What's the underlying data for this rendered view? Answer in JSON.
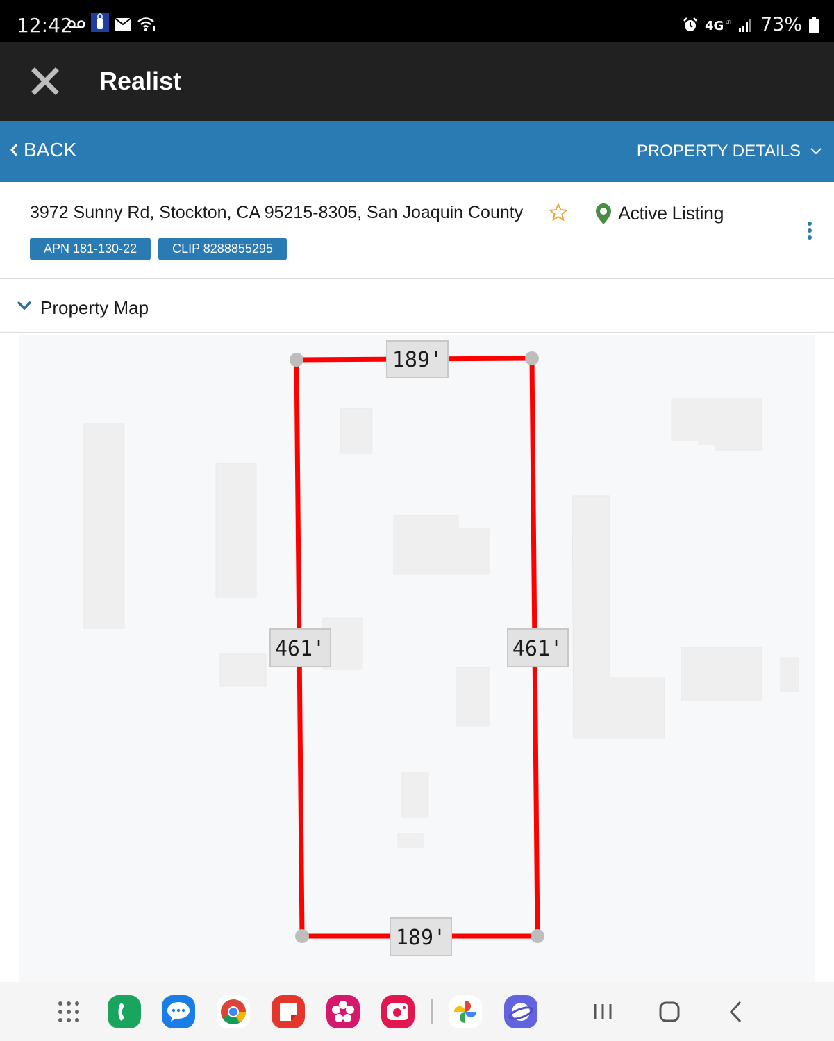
{
  "status_bar": {
    "time": "12:42",
    "left_icons": [
      "voicemail-icon",
      "secure-folder-icon",
      "mail-icon",
      "wifi-icon"
    ],
    "right_icons": [
      "alarm-icon",
      "4g-lte-icon",
      "signal-icon"
    ],
    "battery_percent": "73%"
  },
  "app_bar": {
    "close_icon": "close-icon",
    "title": "Realist"
  },
  "nav": {
    "back_label": "BACK",
    "details_label": "PROPERTY DETAILS"
  },
  "property": {
    "address": "3972 Sunny Rd, Stockton, CA 95215-8305, San Joaquin County",
    "status": "Active Listing",
    "chips": [
      {
        "label": "APN 181-130-22"
      },
      {
        "label": "CLIP 8288855295"
      }
    ],
    "colors": {
      "accent": "#2a7ab3",
      "star": "#e8a33a",
      "pin": "#4a8c45"
    }
  },
  "section": {
    "title": "Property Map"
  },
  "map": {
    "parcel_color": "#ff0000",
    "dimensions": {
      "top": "189'",
      "bottom": "189'",
      "left": "461'",
      "right": "461'"
    }
  },
  "dock": {
    "apps": [
      "app-drawer",
      "phone",
      "messages",
      "chrome",
      "notes",
      "gallery",
      "camera",
      "photos",
      "internet"
    ],
    "nav_buttons": [
      "recents",
      "home",
      "back"
    ]
  }
}
